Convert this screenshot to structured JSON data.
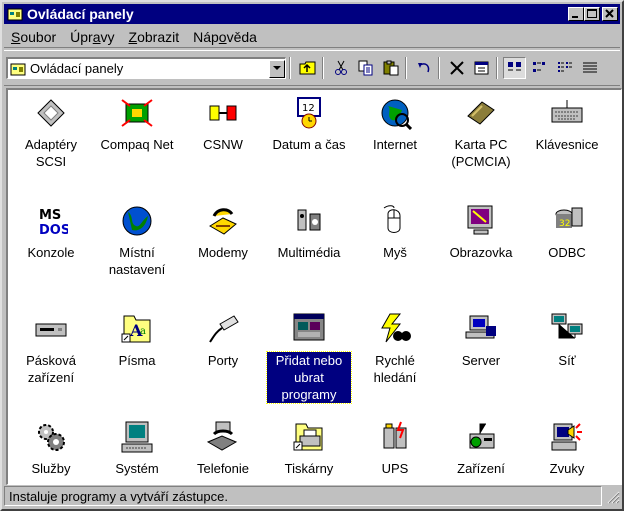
{
  "window": {
    "title": "Ovládací panely"
  },
  "menubar": [
    {
      "label": "Soubor",
      "u": "S",
      "rest": "oubor"
    },
    {
      "label": "Úpravy",
      "pre": "Úpr",
      "u": "a",
      "rest": "vy"
    },
    {
      "label": "Zobrazit",
      "u": "Z",
      "rest": "obrazit"
    },
    {
      "label": "Nápověda",
      "pre": "Náp",
      "u": "o",
      "rest": "věda"
    }
  ],
  "address": {
    "value": "Ovládací panely"
  },
  "toolbar": {
    "buttons": [
      "up-folder",
      "cut",
      "copy",
      "paste",
      "undo",
      "delete",
      "properties",
      "large-icons",
      "small-icons",
      "list",
      "details"
    ]
  },
  "items": [
    {
      "label": "Adaptéry SCSI",
      "icon": "scsi-icon"
    },
    {
      "label": "Compaq Net",
      "icon": "compaq-net-icon"
    },
    {
      "label": "CSNW",
      "icon": "csnw-icon"
    },
    {
      "label": "Datum a čas",
      "icon": "datetime-icon"
    },
    {
      "label": "Internet",
      "icon": "internet-icon"
    },
    {
      "label": "Karta PC (PCMCIA)",
      "icon": "pcmcia-icon"
    },
    {
      "label": "Klávesnice",
      "icon": "keyboard-icon"
    },
    {
      "label": "Konzole",
      "icon": "console-icon"
    },
    {
      "label": "Místní nastavení",
      "icon": "globe-icon"
    },
    {
      "label": "Modemy",
      "icon": "modem-icon"
    },
    {
      "label": "Multimédia",
      "icon": "multimedia-icon"
    },
    {
      "label": "Myš",
      "icon": "mouse-icon"
    },
    {
      "label": "Obrazovka",
      "icon": "display-icon"
    },
    {
      "label": "ODBC",
      "icon": "odbc-icon"
    },
    {
      "label": "Pásková zařízení",
      "icon": "tape-icon"
    },
    {
      "label": "Písma",
      "icon": "fonts-icon"
    },
    {
      "label": "Porty",
      "icon": "ports-icon"
    },
    {
      "label": "Přidat nebo ubrat programy",
      "icon": "add-remove-icon",
      "selected": true
    },
    {
      "label": "Rychlé hledání",
      "icon": "find-fast-icon"
    },
    {
      "label": "Server",
      "icon": "server-icon"
    },
    {
      "label": "Síť",
      "icon": "network-icon"
    },
    {
      "label": "Služby",
      "icon": "services-icon"
    },
    {
      "label": "Systém",
      "icon": "system-icon"
    },
    {
      "label": "Telefonie",
      "icon": "telephony-icon"
    },
    {
      "label": "Tiskárny",
      "icon": "printers-icon"
    },
    {
      "label": "UPS",
      "icon": "ups-icon"
    },
    {
      "label": "Zařízení",
      "icon": "devices-icon"
    },
    {
      "label": "Zvuky",
      "icon": "sounds-icon"
    }
  ],
  "status": {
    "text": "Instaluje programy a vytváří zástupce."
  },
  "colors": {
    "titlebar": "#000080",
    "face": "#c0c0c0",
    "selection": "#000080"
  }
}
